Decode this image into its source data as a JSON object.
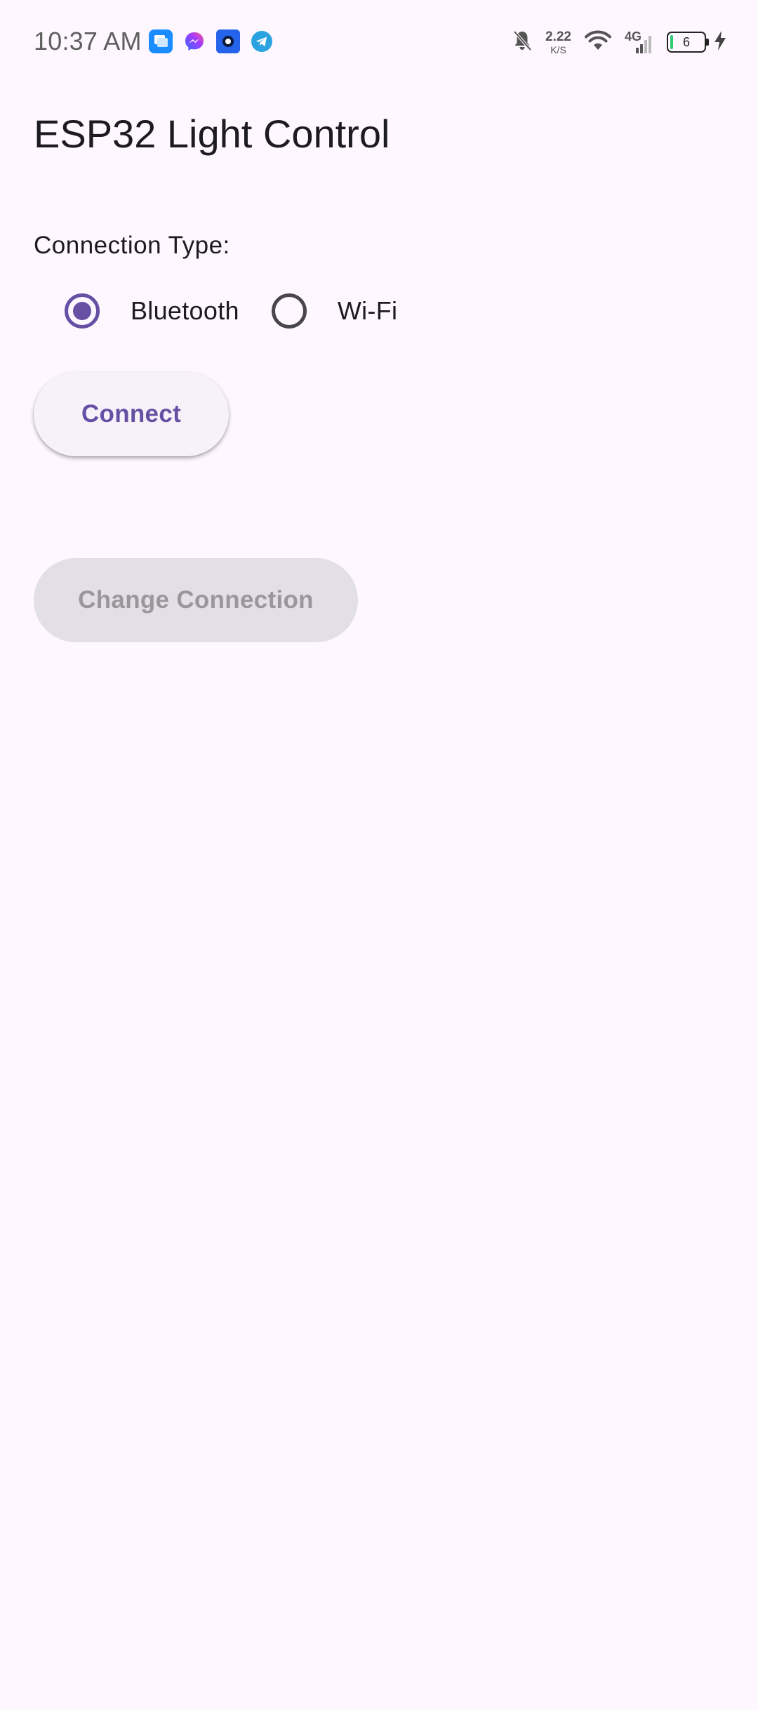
{
  "status_bar": {
    "time": "10:37 AM",
    "notifications": [
      "messages-icon",
      "messenger-icon",
      "app-icon",
      "telegram-icon"
    ],
    "net_speed_value": "2.22",
    "net_speed_unit": "K/S",
    "network_type": "4G",
    "battery_level": "6"
  },
  "app": {
    "title": "ESP32 Light Control"
  },
  "connection": {
    "label": "Connection Type:",
    "options": [
      {
        "label": "Bluetooth",
        "selected": true
      },
      {
        "label": "Wi-Fi",
        "selected": false
      }
    ]
  },
  "actions": {
    "connect_label": "Connect",
    "change_connection_label": "Change Connection"
  },
  "colors": {
    "background": "#FEF7FF",
    "primary": "#6750A4",
    "disabled_bg": "#E3DFE6",
    "disabled_text": "#9A979C"
  }
}
